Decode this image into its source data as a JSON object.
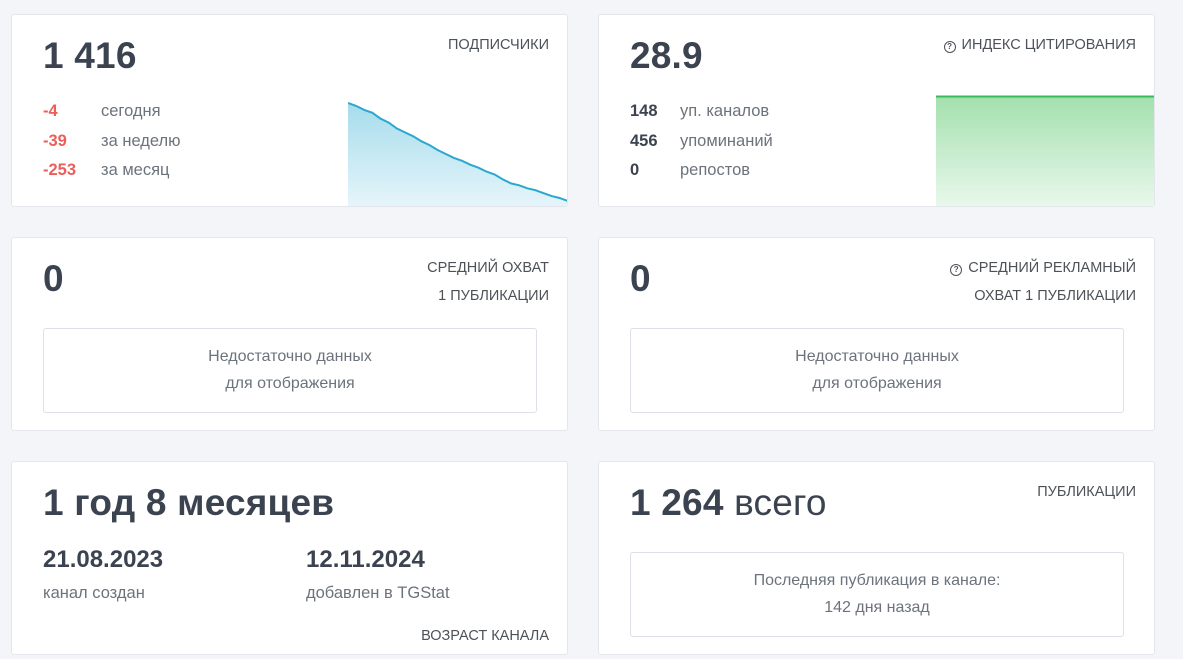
{
  "subscribers": {
    "value": "1 416",
    "label": "ПОДПИСЧИКИ",
    "rows": [
      {
        "value": "-4",
        "text": "сегодня"
      },
      {
        "value": "-39",
        "text": "за неделю"
      },
      {
        "value": "-253",
        "text": "за месяц"
      }
    ],
    "sparkline": [
      1.0,
      0.97,
      0.93,
      0.9,
      0.84,
      0.8,
      0.74,
      0.7,
      0.66,
      0.61,
      0.57,
      0.52,
      0.48,
      0.44,
      0.41,
      0.37,
      0.34,
      0.3,
      0.27,
      0.22,
      0.18,
      0.16,
      0.13,
      0.11,
      0.08,
      0.05,
      0.03,
      0.0
    ]
  },
  "citation": {
    "value": "28.9",
    "label": "ИНДЕКС ЦИТИРОВАНИЯ",
    "rows": [
      {
        "value": "148",
        "text": "уп. каналов"
      },
      {
        "value": "456",
        "text": "упоминаний"
      },
      {
        "value": "0",
        "text": "репостов"
      }
    ]
  },
  "avg_reach": {
    "value": "0",
    "label_line1": "СРЕДНИЙ ОХВАТ",
    "label_line2": "1 ПУБЛИКАЦИИ",
    "nodata_line1": "Недостаточно данных",
    "nodata_line2": "для отображения"
  },
  "avg_ad_reach": {
    "value": "0",
    "label_line1": "СРЕДНИЙ РЕКЛАМНЫЙ",
    "label_line2": "ОХВАТ 1 ПУБЛИКАЦИИ",
    "nodata_line1": "Недостаточно данных",
    "nodata_line2": "для отображения"
  },
  "channel_age": {
    "value": "1 год 8 месяцев",
    "created_date": "21.08.2023",
    "created_label": "канал создан",
    "added_date": "12.11.2024",
    "added_label": "добавлен в TGStat",
    "label": "ВОЗРАСТ КАНАЛА"
  },
  "publications": {
    "value": "1 264",
    "value_suffix": "всего",
    "label": "ПУБЛИКАЦИИ",
    "last_line1": "Последняя публикация в канале:",
    "last_line2": "142 дня назад"
  },
  "colors": {
    "negative": "#ec5f59",
    "sparkline_line": "#2aa8cf",
    "citation_line": "#3cb95a"
  }
}
